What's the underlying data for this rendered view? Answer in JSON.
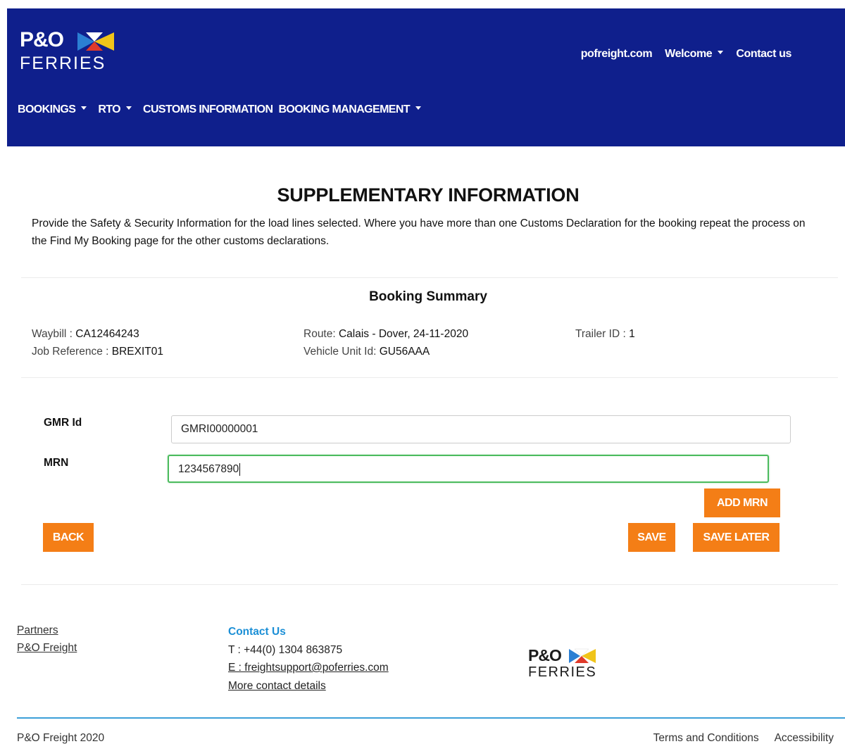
{
  "brand": {
    "logo_top": "P&O",
    "logo_bottom": "FERRIES"
  },
  "header": {
    "top_links": {
      "site": "pofreight.com",
      "welcome": "Welcome",
      "contact": "Contact us"
    },
    "nav": {
      "bookings": "BOOKINGS",
      "rto": "RTO",
      "customs": "CUSTOMS INFORMATION",
      "booking_management": "BOOKING MANAGEMENT"
    }
  },
  "page": {
    "title": "SUPPLEMENTARY INFORMATION",
    "intro": "Provide the Safety & Security Information for the load lines selected. Where you have more than one Customs Declaration for the booking repeat the process on the Find My Booking page for the other customs declarations."
  },
  "summary": {
    "title": "Booking Summary",
    "waybill_label": "Waybill : ",
    "waybill_value": "CA12464243",
    "job_ref_label": "Job Reference : ",
    "job_ref_value": "BREXIT01",
    "route_label": "Route: ",
    "route_value": "Calais - Dover, 24-11-2020",
    "vehicle_label": "Vehicle Unit Id: ",
    "vehicle_value": "GU56AAA",
    "trailer_label": "Trailer ID : ",
    "trailer_value": "1"
  },
  "form": {
    "gmr_label": "GMR Id",
    "gmr_value": "GMRI00000001",
    "mrn_label": "MRN",
    "mrn_value": "1234567890",
    "add_mrn": "ADD MRN",
    "back": "BACK",
    "save": "SAVE",
    "save_later": "SAVE LATER"
  },
  "footer": {
    "partners": "Partners",
    "po_freight": "P&O Freight",
    "contact_head": "Contact Us",
    "phone": "T : +44(0) 1304 863875",
    "email": "E : freightsupport@poferries.com",
    "more_contact": "More contact details",
    "copyright": "P&O Freight 2020",
    "terms": "Terms and Conditions",
    "accessibility": "Accessibility"
  },
  "colors": {
    "header_bg": "#0f1f8c",
    "button": "#f47e16",
    "accent_blue": "#1b8fd6",
    "focus_green": "#4cbb5e"
  }
}
